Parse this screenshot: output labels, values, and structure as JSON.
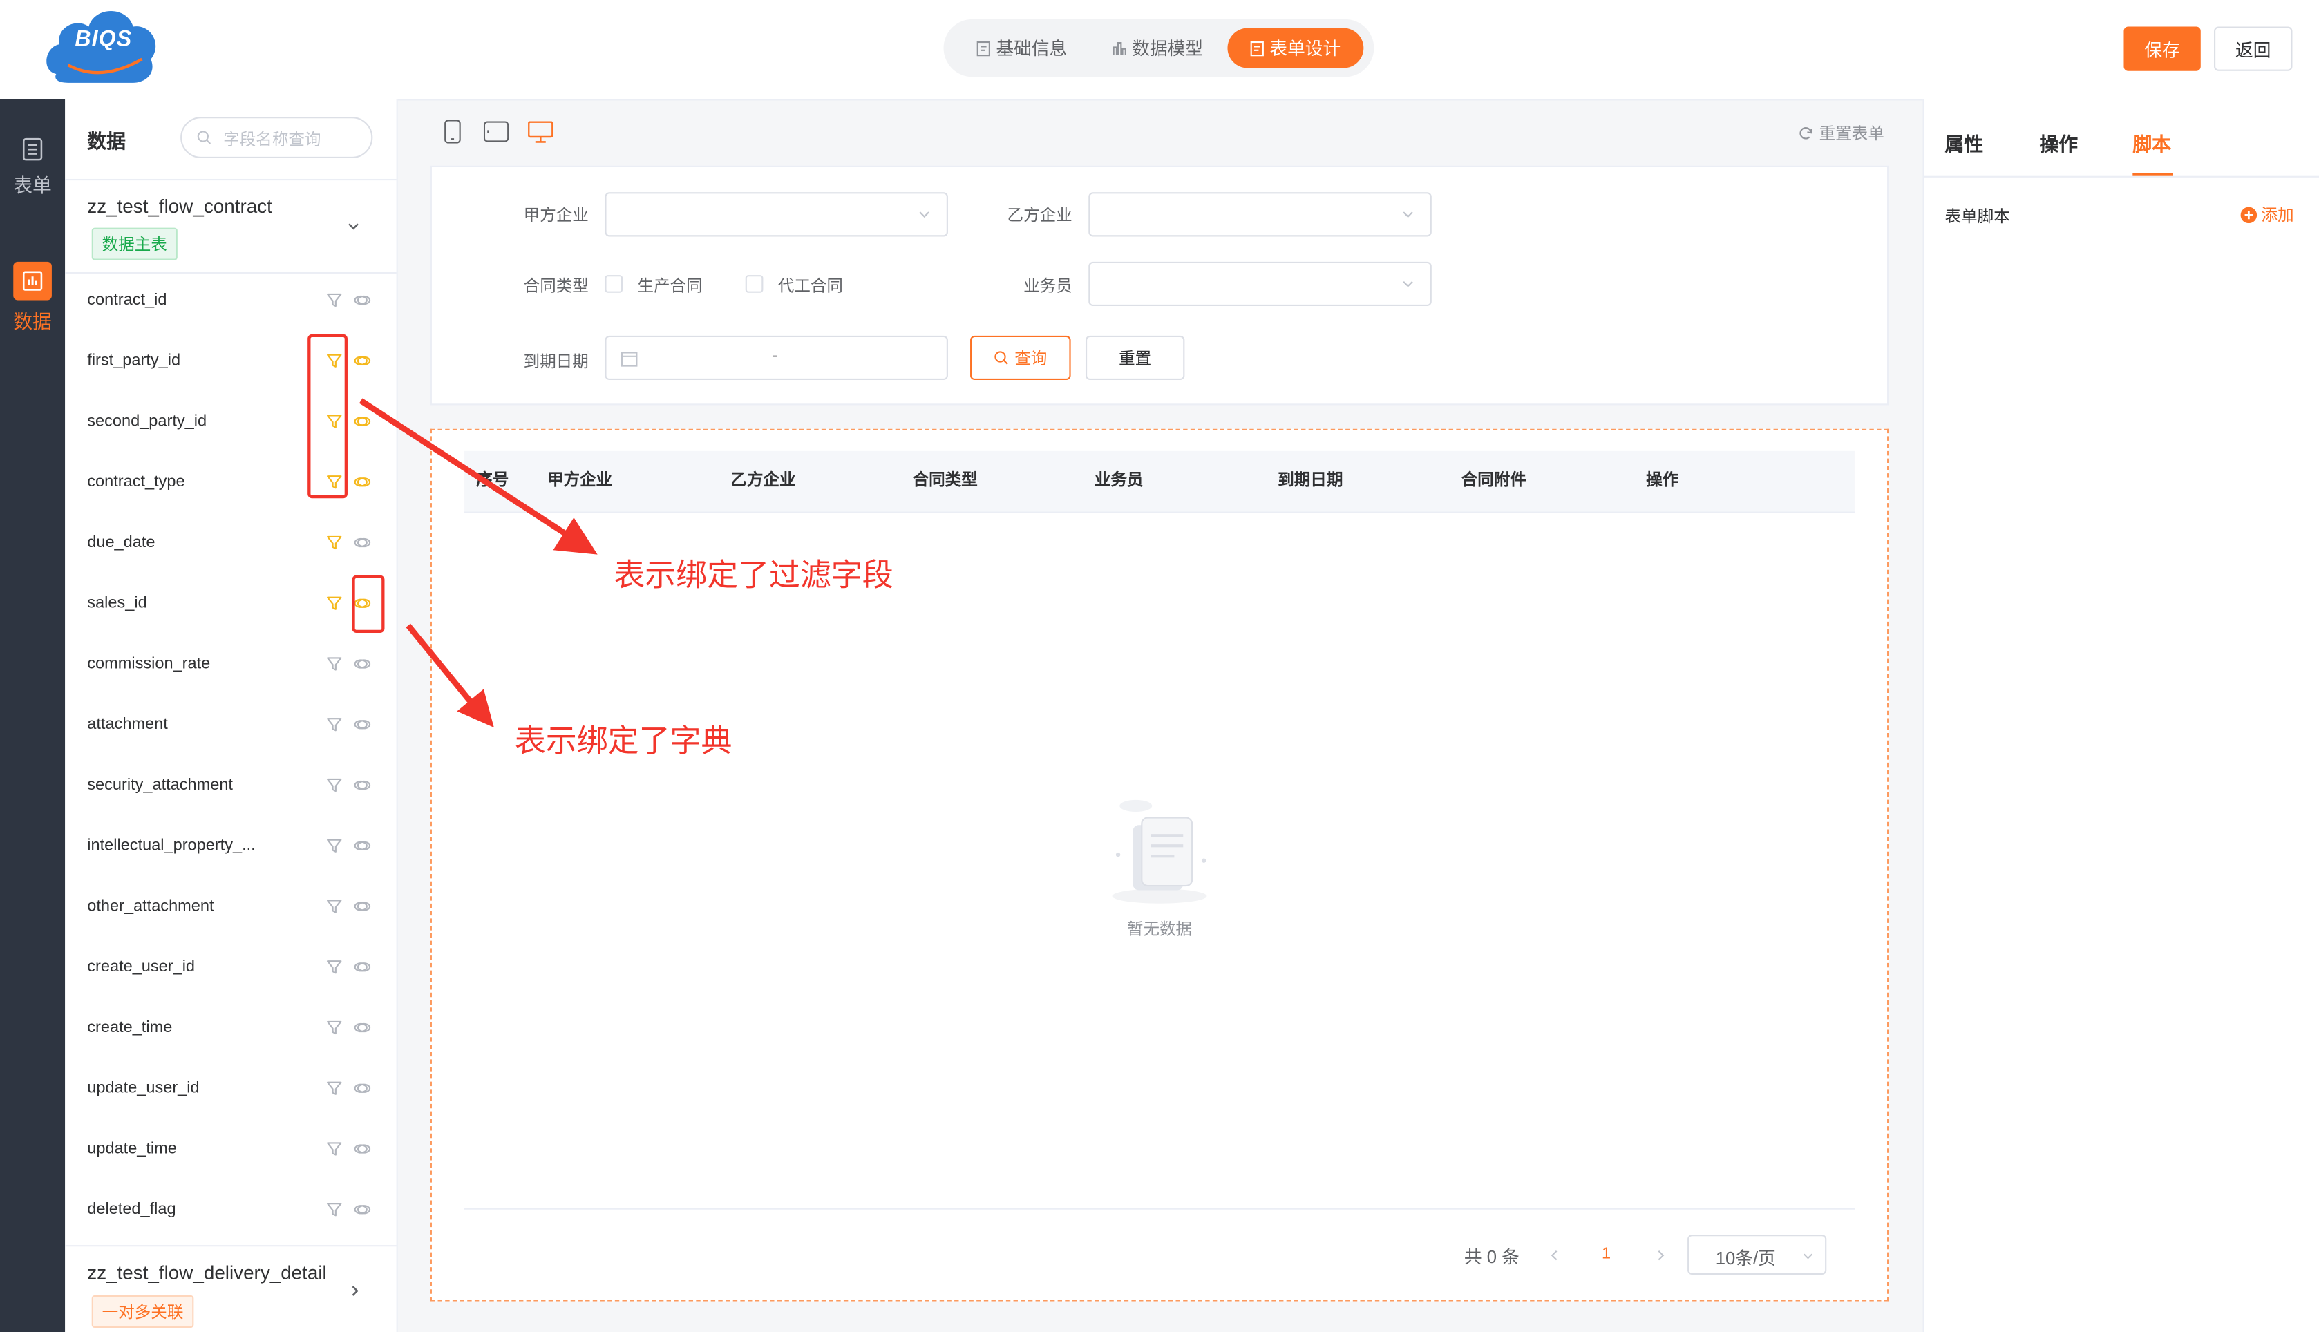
{
  "app": {
    "logo_text": "BIQS"
  },
  "header": {
    "tabs": [
      {
        "label": "基础信息",
        "icon": "form-icon",
        "active": false
      },
      {
        "label": "数据模型",
        "icon": "chart-icon",
        "active": false
      },
      {
        "label": "表单设计",
        "icon": "form-icon",
        "active": true
      }
    ],
    "save_label": "保存",
    "back_label": "返回"
  },
  "rail": {
    "items": [
      {
        "label": "表单",
        "icon": "list-icon",
        "active": false
      },
      {
        "label": "数据",
        "icon": "data-icon",
        "active": true
      }
    ]
  },
  "field_panel": {
    "title": "数据",
    "search_placeholder": "字段名称查询",
    "main_table": {
      "name": "zz_test_flow_contract",
      "badge": "数据主表"
    },
    "fields": [
      {
        "name": "contract_id",
        "filter_bound": false,
        "dict_bound": false
      },
      {
        "name": "first_party_id",
        "filter_bound": true,
        "dict_bound": true
      },
      {
        "name": "second_party_id",
        "filter_bound": true,
        "dict_bound": true
      },
      {
        "name": "contract_type",
        "filter_bound": true,
        "dict_bound": true
      },
      {
        "name": "due_date",
        "filter_bound": true,
        "dict_bound": false
      },
      {
        "name": "sales_id",
        "filter_bound": true,
        "dict_bound": true
      },
      {
        "name": "commission_rate",
        "filter_bound": false,
        "dict_bound": false
      },
      {
        "name": "attachment",
        "filter_bound": false,
        "dict_bound": false
      },
      {
        "name": "security_attachment",
        "filter_bound": false,
        "dict_bound": false
      },
      {
        "name": "intellectual_property_...",
        "filter_bound": false,
        "dict_bound": false
      },
      {
        "name": "other_attachment",
        "filter_bound": false,
        "dict_bound": false
      },
      {
        "name": "create_user_id",
        "filter_bound": false,
        "dict_bound": false
      },
      {
        "name": "create_time",
        "filter_bound": false,
        "dict_bound": false
      },
      {
        "name": "update_user_id",
        "filter_bound": false,
        "dict_bound": false
      },
      {
        "name": "update_time",
        "filter_bound": false,
        "dict_bound": false
      },
      {
        "name": "deleted_flag",
        "filter_bound": false,
        "dict_bound": false
      }
    ],
    "related_table": {
      "name": "zz_test_flow_delivery_detail",
      "badge": "一对多关联"
    }
  },
  "toolbar": {
    "devices": [
      "mobile-icon",
      "tablet-icon",
      "desktop-icon"
    ],
    "active_device": "desktop-icon",
    "reset_label": "重置表单"
  },
  "filter_form": {
    "first_party_label": "甲方企业",
    "second_party_label": "乙方企业",
    "contract_type_label": "合同类型",
    "contract_type_options": [
      "生产合同",
      "代工合同"
    ],
    "sales_label": "业务员",
    "due_date_label": "到期日期",
    "date_separator": "-",
    "query_label": "查询",
    "reset_label": "重置"
  },
  "table": {
    "columns": [
      "序号",
      "甲方企业",
      "乙方企业",
      "合同类型",
      "业务员",
      "到期日期",
      "合同附件",
      "操作"
    ],
    "empty_text": "暂无数据",
    "pagination": {
      "total_text": "共 0 条",
      "current_page": "1",
      "page_size": "10条/页"
    }
  },
  "right_panel": {
    "tabs": [
      {
        "label": "属性",
        "active": false
      },
      {
        "label": "操作",
        "active": false
      },
      {
        "label": "脚本",
        "active": true
      }
    ],
    "script_label": "表单脚本",
    "add_label": "添加"
  },
  "annotations": {
    "filter_note": "表示绑定了过滤字段",
    "dict_note": "表示绑定了字典"
  },
  "colors": {
    "accent": "#fd7224",
    "annotation": "#f2352b",
    "rail_bg": "#2e3541",
    "bound_icon": "#f5b81c"
  }
}
